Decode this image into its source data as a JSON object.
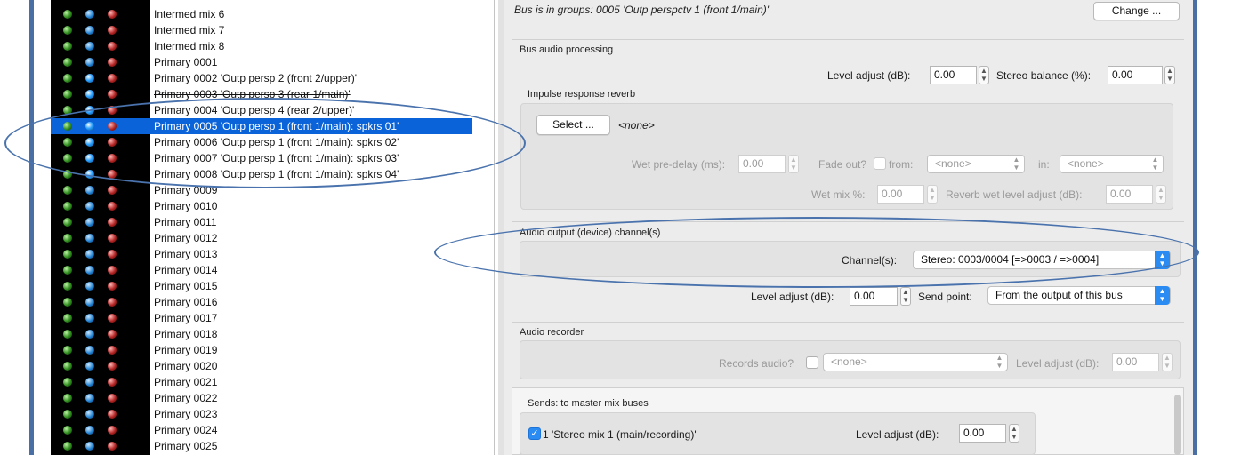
{
  "bus_list": {
    "items": [
      {
        "label": "Intermed mix 6",
        "selected": false,
        "struck": false,
        "blue_on": false
      },
      {
        "label": "Intermed mix 7",
        "selected": false,
        "struck": false,
        "blue_on": false
      },
      {
        "label": "Intermed mix 8",
        "selected": false,
        "struck": false,
        "blue_on": false
      },
      {
        "label": "Primary 0001",
        "selected": false,
        "struck": false,
        "blue_on": false
      },
      {
        "label": "Primary 0002 'Outp persp 2 (front 2/upper)'",
        "selected": false,
        "struck": false,
        "blue_on": true
      },
      {
        "label": "Primary 0003 'Outp persp 3 (rear 1/main)'",
        "selected": false,
        "struck": true,
        "blue_on": true
      },
      {
        "label": "Primary 0004 'Outp persp 4 (rear 2/upper)'",
        "selected": false,
        "struck": false,
        "blue_on": true
      },
      {
        "label": "Primary 0005 'Outp persp 1 (front 1/main): spkrs 01'",
        "selected": true,
        "struck": false,
        "blue_on": true
      },
      {
        "label": "Primary 0006 'Outp persp 1 (front 1/main): spkrs 02'",
        "selected": false,
        "struck": false,
        "blue_on": true
      },
      {
        "label": "Primary 0007 'Outp persp 1 (front 1/main): spkrs 03'",
        "selected": false,
        "struck": false,
        "blue_on": true
      },
      {
        "label": "Primary 0008 'Outp persp 1 (front 1/main): spkrs 04'",
        "selected": false,
        "struck": false,
        "blue_on": true
      },
      {
        "label": "Primary 0009",
        "selected": false,
        "struck": false,
        "blue_on": false
      },
      {
        "label": "Primary 0010",
        "selected": false,
        "struck": false,
        "blue_on": false
      },
      {
        "label": "Primary 0011",
        "selected": false,
        "struck": false,
        "blue_on": false
      },
      {
        "label": "Primary 0012",
        "selected": false,
        "struck": false,
        "blue_on": false
      },
      {
        "label": "Primary 0013",
        "selected": false,
        "struck": false,
        "blue_on": false
      },
      {
        "label": "Primary 0014",
        "selected": false,
        "struck": false,
        "blue_on": false
      },
      {
        "label": "Primary 0015",
        "selected": false,
        "struck": false,
        "blue_on": false
      },
      {
        "label": "Primary 0016",
        "selected": false,
        "struck": false,
        "blue_on": false
      },
      {
        "label": "Primary 0017",
        "selected": false,
        "struck": false,
        "blue_on": false
      },
      {
        "label": "Primary 0018",
        "selected": false,
        "struck": false,
        "blue_on": false
      },
      {
        "label": "Primary 0019",
        "selected": false,
        "struck": false,
        "blue_on": false
      },
      {
        "label": "Primary 0020",
        "selected": false,
        "struck": false,
        "blue_on": false
      },
      {
        "label": "Primary 0021",
        "selected": false,
        "struck": false,
        "blue_on": false
      },
      {
        "label": "Primary 0022",
        "selected": false,
        "struck": false,
        "blue_on": false
      },
      {
        "label": "Primary 0023",
        "selected": false,
        "struck": false,
        "blue_on": false
      },
      {
        "label": "Primary 0024",
        "selected": false,
        "struck": false,
        "blue_on": false
      },
      {
        "label": "Primary 0025",
        "selected": false,
        "struck": false,
        "blue_on": false
      }
    ]
  },
  "panel": {
    "groups_text": "Bus is in groups: 0005 'Outp perspctv 1 (front 1/main)'",
    "change_button": "Change ...",
    "audio_processing": {
      "title": "Bus audio processing",
      "level_adjust_label": "Level adjust (dB):",
      "level_adjust_value": "0.00",
      "stereo_balance_label": "Stereo balance (%):",
      "stereo_balance_value": "0.00"
    },
    "reverb": {
      "title": "Impulse response reverb",
      "select_button": "Select ...",
      "selected_file": "<none>",
      "wet_predelay_label": "Wet pre-delay (ms):",
      "wet_predelay_value": "0.00",
      "fade_out_label": "Fade out?",
      "from_label": "from:",
      "from_value": "<none>",
      "in_label": "in:",
      "in_value": "<none>",
      "wet_mix_label": "Wet mix %:",
      "wet_mix_value": "0.00",
      "reverb_wet_level_label": "Reverb wet level adjust (dB):",
      "reverb_wet_level_value": "0.00"
    },
    "output": {
      "title": "Audio output (device) channel(s)",
      "channels_label": "Channel(s):",
      "channels_value": "Stereo: 0003/0004 [=>0003 / =>0004]",
      "level_adjust_label": "Level adjust (dB):",
      "level_adjust_value": "0.00",
      "send_point_label": "Send point:",
      "send_point_value": "From the output of this bus"
    },
    "recorder": {
      "title": "Audio recorder",
      "records_label": "Records audio?",
      "records_value": "<none>",
      "level_adjust_label": "Level adjust (dB):",
      "level_adjust_value": "0.00"
    },
    "sends": {
      "title": "Sends: to master mix buses",
      "items": [
        {
          "label": "1 'Stereo mix 1 (main/recording)'",
          "level_label": "Level adjust (dB):",
          "level_value": "0.00"
        }
      ]
    }
  },
  "colors": {
    "selection": "#0a63d8",
    "annotation": "#4a73ad",
    "accent": "#2a8bf2"
  }
}
